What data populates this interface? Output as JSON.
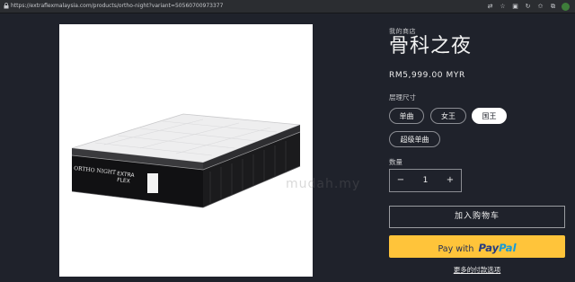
{
  "browser": {
    "url": "https://extraflexmalaysia.com/products/ortho-night?variant=50560700973377"
  },
  "image": {
    "watermark": "mudah.my",
    "brand": "ORTHO NIGHT",
    "label_line1": "EXTRA",
    "label_line2": "FLEX"
  },
  "product": {
    "vendor": "我的商店",
    "title": "骨科之夜",
    "price": "RM5,999.00 MYR",
    "size_label": "层理尺寸",
    "sizes": [
      {
        "label": "单曲",
        "selected": false
      },
      {
        "label": "女王",
        "selected": false
      },
      {
        "label": "国王",
        "selected": true
      },
      {
        "label": "超级单曲",
        "selected": false
      }
    ],
    "quantity_label": "数量",
    "quantity": "1",
    "minus": "−",
    "plus": "+",
    "add_to_cart": "加入购物车",
    "paypal_prefix": "Pay with",
    "paypal_pay": "Pay",
    "paypal_pal": "Pal",
    "more_payment": "更多的付款选项"
  }
}
